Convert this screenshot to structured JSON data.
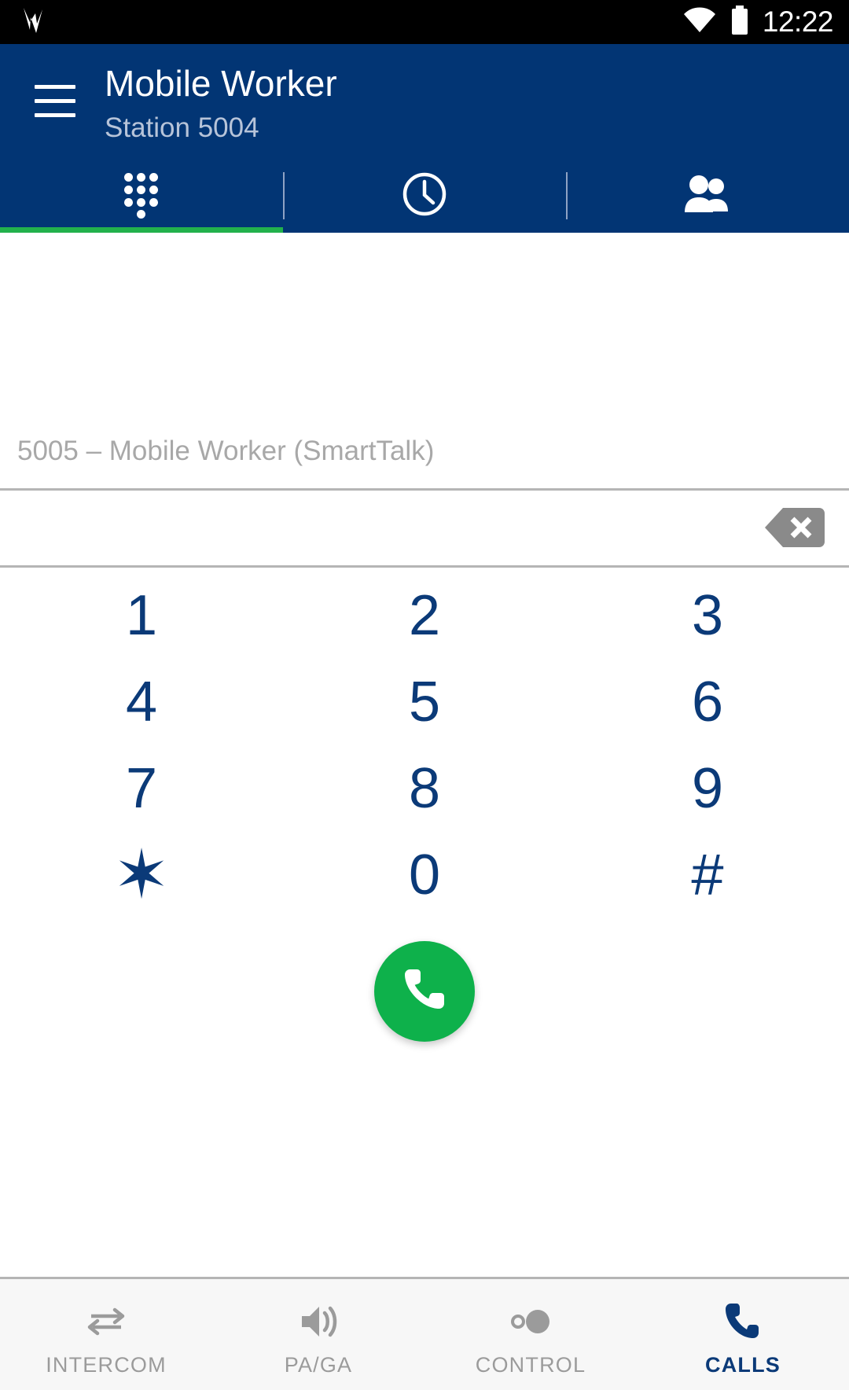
{
  "status_bar": {
    "time": "12:22",
    "icons": [
      "notification-arrow-icon",
      "wifi-icon",
      "battery-full-icon"
    ],
    "background": "#000000"
  },
  "app_bar": {
    "title": "Mobile Worker",
    "subtitle": "Station 5004",
    "menu_icon": "hamburger-menu-icon",
    "background": "#023574",
    "accent": "#22b14c"
  },
  "top_tabs": {
    "active_index": 0,
    "items": [
      {
        "label": "",
        "icon": "dialpad-icon",
        "active": true
      },
      {
        "label": "",
        "icon": "clock-recents-icon",
        "active": false
      },
      {
        "label": "",
        "icon": "contacts-people-icon",
        "active": false
      }
    ]
  },
  "dialer": {
    "suggestion_number": "5005",
    "suggestion_separator": " – ",
    "suggestion_name": "Mobile Worker (SmartTalk)",
    "suggestion_full": "5005  – Mobile Worker (SmartTalk)",
    "input_value": "",
    "input_placeholder": "",
    "backspace_icon": "backspace-delete-icon",
    "backspace_color": "#8a8a8a",
    "key_color": "#0b3a78",
    "keys": [
      [
        "1",
        "2",
        "3"
      ],
      [
        "4",
        "5",
        "6"
      ],
      [
        "7",
        "8",
        "9"
      ],
      [
        "✶",
        "0",
        "#"
      ]
    ],
    "call_button": {
      "icon": "phone-call-icon",
      "color": "#0eb14b",
      "label": ""
    }
  },
  "bottom_nav": {
    "active_index": 3,
    "items": [
      {
        "label": "INTERCOM",
        "icon": "swap-arrows-icon",
        "active": false
      },
      {
        "label": "PA/GA",
        "icon": "volume-speaker-icon",
        "active": false
      },
      {
        "label": "CONTROL",
        "icon": "toggle-control-icon",
        "active": false
      },
      {
        "label": "CALLS",
        "icon": "phone-handset-icon",
        "active": true
      }
    ],
    "background": "#f7f7f7",
    "active_color": "#0b3a78",
    "inactive_color": "#9b9b9b"
  }
}
